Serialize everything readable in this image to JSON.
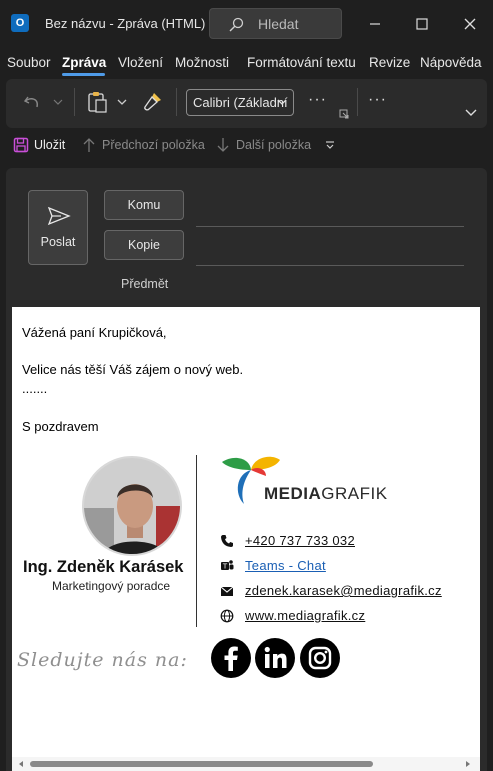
{
  "window": {
    "app_icon_letter": "O",
    "title": "Bez názvu  -  Zpráva (HTML)",
    "search_placeholder": "Hledat"
  },
  "menu": {
    "items": [
      "Soubor",
      "Zpráva",
      "Vložení",
      "Možnosti",
      "Formátování textu",
      "Revize",
      "Nápověda"
    ],
    "active": "Zpráva"
  },
  "ribbon": {
    "font_name": "Calibri (Základní",
    "more_label": "···"
  },
  "quickbar": {
    "save_label": "Uložit",
    "prev_label": "Předchozí položka",
    "next_label": "Další položka"
  },
  "compose": {
    "send_label": "Poslat",
    "to_label": "Komu",
    "cc_label": "Kopie",
    "subject_label": "Předmět"
  },
  "body": {
    "greeting": "Vážená paní Krupičková,",
    "line1": "Velice nás těší Váš zájem o nový web.",
    "line2": ".......",
    "closing": "S pozdravem"
  },
  "signature": {
    "name": "Ing. Zdeněk Karásek",
    "role": "Marketingový poradce",
    "brand_bold": "MEDIA",
    "brand_light": "GRAFIK",
    "phone": "+420 737 733 032",
    "teams": "Teams - Chat",
    "email": "zdenek.karasek@mediagrafik.cz",
    "web": "www.mediagrafik.cz",
    "follow": "Sledujte nás na:",
    "social": [
      "facebook-icon",
      "linkedin-icon",
      "instagram-icon"
    ]
  },
  "colors": {
    "accent": "#4f9be8",
    "save_icon": "#c94fd8",
    "teams_link": "#1a5fb4",
    "logo_green": "#2e9d47",
    "logo_blue": "#1f6fb8",
    "logo_yellow": "#f4b400",
    "logo_red": "#e53935"
  }
}
